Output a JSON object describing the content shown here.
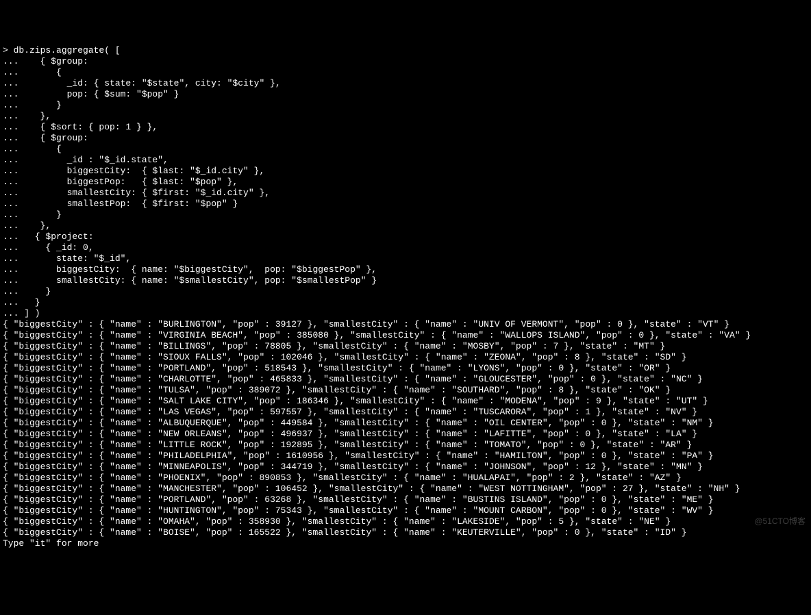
{
  "command_lines": [
    "> db.zips.aggregate( [",
    "...    { $group:",
    "...       {",
    "...         _id: { state: \"$state\", city: \"$city\" },",
    "...         pop: { $sum: \"$pop\" }",
    "...       }",
    "...    },",
    "...    { $sort: { pop: 1 } },",
    "...    { $group:",
    "...       {",
    "...         _id : \"$_id.state\",",
    "...         biggestCity:  { $last: \"$_id.city\" },",
    "...         biggestPop:   { $last: \"$pop\" },",
    "...         smallestCity: { $first: \"$_id.city\" },",
    "...         smallestPop:  { $first: \"$pop\" }",
    "...       }",
    "...    },",
    "...   { $project:",
    "...     { _id: 0,",
    "...       state: \"$_id\",",
    "...       biggestCity:  { name: \"$biggestCity\",  pop: \"$biggestPop\" },",
    "...       smallestCity: { name: \"$smallestCity\", pop: \"$smallestPop\" }",
    "...     }",
    "...   }",
    "... ] )"
  ],
  "results": [
    {
      "biggestCity": {
        "name": "BURLINGTON",
        "pop": 39127
      },
      "smallestCity": {
        "name": "UNIV OF VERMONT",
        "pop": 0
      },
      "state": "VT"
    },
    {
      "biggestCity": {
        "name": "VIRGINIA BEACH",
        "pop": 385080
      },
      "smallestCity": {
        "name": "WALLOPS ISLAND",
        "pop": 0
      },
      "state": "VA"
    },
    {
      "biggestCity": {
        "name": "BILLINGS",
        "pop": 78805
      },
      "smallestCity": {
        "name": "MOSBY",
        "pop": 7
      },
      "state": "MT"
    },
    {
      "biggestCity": {
        "name": "SIOUX FALLS",
        "pop": 102046
      },
      "smallestCity": {
        "name": "ZEONA",
        "pop": 8
      },
      "state": "SD"
    },
    {
      "biggestCity": {
        "name": "PORTLAND",
        "pop": 518543
      },
      "smallestCity": {
        "name": "LYONS",
        "pop": 0
      },
      "state": "OR"
    },
    {
      "biggestCity": {
        "name": "CHARLOTTE",
        "pop": 465833
      },
      "smallestCity": {
        "name": "GLOUCESTER",
        "pop": 0
      },
      "state": "NC"
    },
    {
      "biggestCity": {
        "name": "TULSA",
        "pop": 389072
      },
      "smallestCity": {
        "name": "SOUTHARD",
        "pop": 8
      },
      "state": "OK"
    },
    {
      "biggestCity": {
        "name": "SALT LAKE CITY",
        "pop": 186346
      },
      "smallestCity": {
        "name": "MODENA",
        "pop": 9
      },
      "state": "UT"
    },
    {
      "biggestCity": {
        "name": "LAS VEGAS",
        "pop": 597557
      },
      "smallestCity": {
        "name": "TUSCARORA",
        "pop": 1
      },
      "state": "NV"
    },
    {
      "biggestCity": {
        "name": "ALBUQUERQUE",
        "pop": 449584
      },
      "smallestCity": {
        "name": "OIL CENTER",
        "pop": 0
      },
      "state": "NM"
    },
    {
      "biggestCity": {
        "name": "NEW ORLEANS",
        "pop": 496937
      },
      "smallestCity": {
        "name": "LAFITTE",
        "pop": 0
      },
      "state": "LA"
    },
    {
      "biggestCity": {
        "name": "LITTLE ROCK",
        "pop": 192895
      },
      "smallestCity": {
        "name": "TOMATO",
        "pop": 0
      },
      "state": "AR"
    },
    {
      "biggestCity": {
        "name": "PHILADELPHIA",
        "pop": 1610956
      },
      "smallestCity": {
        "name": "HAMILTON",
        "pop": 0
      },
      "state": "PA"
    },
    {
      "biggestCity": {
        "name": "MINNEAPOLIS",
        "pop": 344719
      },
      "smallestCity": {
        "name": "JOHNSON",
        "pop": 12
      },
      "state": "MN"
    },
    {
      "biggestCity": {
        "name": "PHOENIX",
        "pop": 890853
      },
      "smallestCity": {
        "name": "HUALAPAI",
        "pop": 2
      },
      "state": "AZ"
    },
    {
      "biggestCity": {
        "name": "MANCHESTER",
        "pop": 106452
      },
      "smallestCity": {
        "name": "WEST NOTTINGHAM",
        "pop": 27
      },
      "state": "NH"
    },
    {
      "biggestCity": {
        "name": "PORTLAND",
        "pop": 63268
      },
      "smallestCity": {
        "name": "BUSTINS ISLAND",
        "pop": 0
      },
      "state": "ME"
    },
    {
      "biggestCity": {
        "name": "HUNTINGTON",
        "pop": 75343
      },
      "smallestCity": {
        "name": "MOUNT CARBON",
        "pop": 0
      },
      "state": "WV"
    },
    {
      "biggestCity": {
        "name": "OMAHA",
        "pop": 358930
      },
      "smallestCity": {
        "name": "LAKESIDE",
        "pop": 5
      },
      "state": "NE"
    },
    {
      "biggestCity": {
        "name": "BOISE",
        "pop": 165522
      },
      "smallestCity": {
        "name": "KEUTERVILLE",
        "pop": 0
      },
      "state": "ID"
    }
  ],
  "footer": "Type \"it\" for more",
  "watermark": "@51CTO博客"
}
